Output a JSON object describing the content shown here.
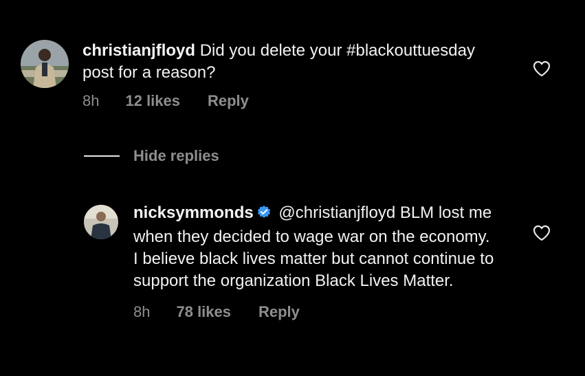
{
  "comments": [
    {
      "username": "christianjfloyd",
      "text": " Did you delete your #blackouttuesday post for a reason?",
      "time": "8h",
      "likes": "12 likes",
      "reply": "Reply",
      "verified": false
    }
  ],
  "hide_replies_label": "Hide replies",
  "replies": [
    {
      "username": "nicksymmonds",
      "text": " @christianjfloyd BLM lost me when they decided to wage war on the economy. I believe black lives matter but cannot continue to support the organization Black Lives Matter.",
      "time": "8h",
      "likes": "78 likes",
      "reply": "Reply",
      "verified": true
    }
  ],
  "colors": {
    "background": "#000000",
    "text": "#f2f2f2",
    "muted": "#8e8e8e",
    "verified_badge": "#3897f0"
  },
  "icons": {
    "like": "heart-outline-icon",
    "verified": "verified-badge-icon"
  }
}
